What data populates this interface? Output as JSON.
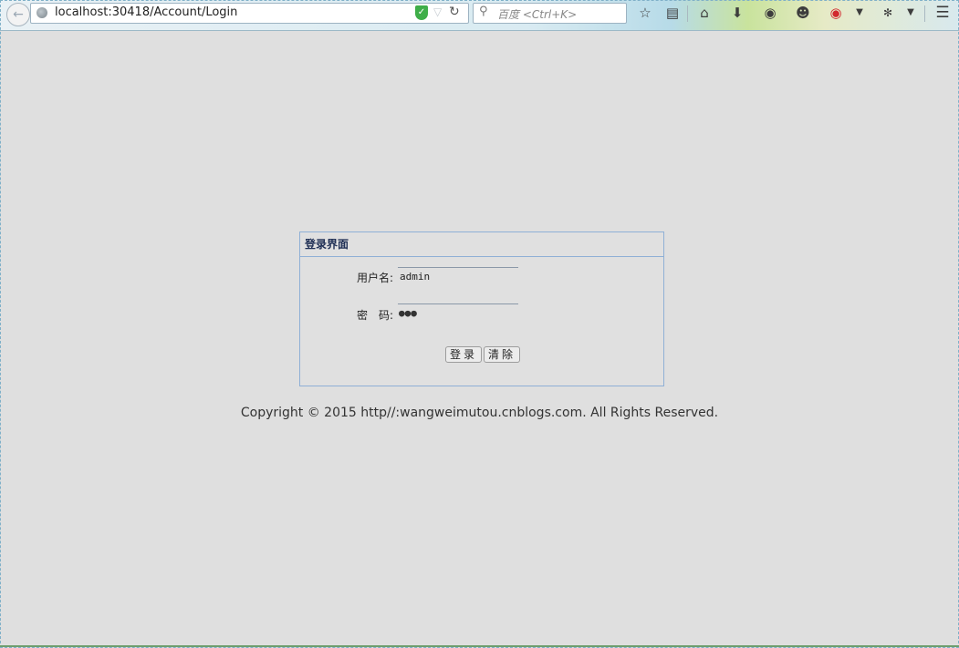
{
  "browser": {
    "url": "localhost:30418/Account/Login",
    "search_placeholder": "百度 <Ctrl+K>",
    "icons": {
      "back": "back-arrow-icon",
      "globe": "globe-icon",
      "shield": "shield-icon",
      "reload": "reload-icon",
      "search": "search-icon",
      "bookmark": "bookmark-star-icon",
      "reading_list": "reading-list-icon",
      "home": "home-icon",
      "download": "download-icon",
      "chat": "chat-icon",
      "user": "user-icon",
      "weibo": "weibo-icon",
      "menu": "hamburger-menu-icon"
    }
  },
  "login": {
    "title": "登录界面",
    "username_label": "用户名:",
    "username_value": "admin",
    "password_label": "密　码:",
    "password_mask": "●●●",
    "login_button": "登录",
    "clear_button": "清除"
  },
  "footer": {
    "copyright": "Copyright © 2015 http//:wangweimutou.cnblogs.com. All Rights Reserved."
  },
  "colors": {
    "page_background": "#dfdfdf",
    "panel_border": "#8fb0d6",
    "panel_title": "#1f2f55"
  }
}
